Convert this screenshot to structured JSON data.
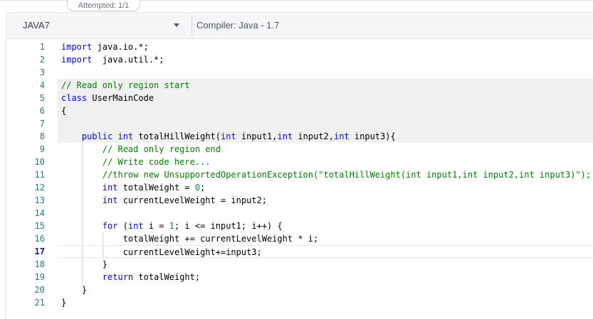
{
  "header": {
    "attempt_label": "Attempted: 1/1"
  },
  "toolbar": {
    "language": "JAVA7",
    "compiler": "Compiler: Java - 1.7",
    "dropdown_icon": "caret-down-icon"
  },
  "editor": {
    "active_line": 17,
    "lines": [
      {
        "n": "1",
        "tokens": [
          {
            "t": "kw",
            "v": "import"
          },
          {
            "t": "p",
            "v": " java.io.*;"
          }
        ]
      },
      {
        "n": "2",
        "tokens": [
          {
            "t": "kw",
            "v": "import"
          },
          {
            "t": "p",
            "v": "  java.util.*;"
          }
        ]
      },
      {
        "n": "3",
        "tokens": []
      },
      {
        "n": "4",
        "tokens": [
          {
            "t": "cm",
            "v": "// Read only region start"
          }
        ]
      },
      {
        "n": "5",
        "tokens": [
          {
            "t": "kw",
            "v": "class"
          },
          {
            "t": "p",
            "v": " UserMainCode"
          }
        ]
      },
      {
        "n": "6",
        "tokens": [
          {
            "t": "p",
            "v": "{"
          }
        ]
      },
      {
        "n": "7",
        "tokens": []
      },
      {
        "n": "8",
        "tokens": [
          {
            "t": "p",
            "v": "    "
          },
          {
            "t": "kw",
            "v": "public"
          },
          {
            "t": "p",
            "v": " "
          },
          {
            "t": "kw",
            "v": "int"
          },
          {
            "t": "p",
            "v": " totalHillWeight("
          },
          {
            "t": "kw",
            "v": "int"
          },
          {
            "t": "p",
            "v": " input1,"
          },
          {
            "t": "kw",
            "v": "int"
          },
          {
            "t": "p",
            "v": " input2,"
          },
          {
            "t": "kw",
            "v": "int"
          },
          {
            "t": "p",
            "v": " input3){"
          }
        ]
      },
      {
        "n": "9",
        "tokens": [
          {
            "t": "p",
            "v": "        "
          },
          {
            "t": "cm",
            "v": "// Read only region end"
          }
        ]
      },
      {
        "n": "10",
        "tokens": [
          {
            "t": "p",
            "v": "        "
          },
          {
            "t": "cm",
            "v": "// Write code here..."
          }
        ]
      },
      {
        "n": "11",
        "tokens": [
          {
            "t": "p",
            "v": "        "
          },
          {
            "t": "cm",
            "v": "//throw new UnsupportedOperationException(\"totalHillWeight(int input1,int input2,int input3)\");"
          }
        ]
      },
      {
        "n": "12",
        "tokens": [
          {
            "t": "p",
            "v": "        "
          },
          {
            "t": "kw",
            "v": "int"
          },
          {
            "t": "p",
            "v": " totalWeight = "
          },
          {
            "t": "num",
            "v": "0"
          },
          {
            "t": "p",
            "v": ";"
          }
        ]
      },
      {
        "n": "13",
        "tokens": [
          {
            "t": "p",
            "v": "        "
          },
          {
            "t": "kw",
            "v": "int"
          },
          {
            "t": "p",
            "v": " currentLevelWeight = input2;"
          }
        ]
      },
      {
        "n": "14",
        "tokens": []
      },
      {
        "n": "15",
        "tokens": [
          {
            "t": "p",
            "v": "        "
          },
          {
            "t": "kw",
            "v": "for"
          },
          {
            "t": "p",
            "v": " ("
          },
          {
            "t": "kw",
            "v": "int"
          },
          {
            "t": "p",
            "v": " i = "
          },
          {
            "t": "num",
            "v": "1"
          },
          {
            "t": "p",
            "v": "; i <= input1; i++) {"
          }
        ]
      },
      {
        "n": "16",
        "tokens": [
          {
            "t": "p",
            "v": "            totalWeight += currentLevelWeight * i;"
          }
        ]
      },
      {
        "n": "17",
        "tokens": [
          {
            "t": "p",
            "v": "            currentLevelWeight+=input3;"
          }
        ]
      },
      {
        "n": "18",
        "tokens": [
          {
            "t": "p",
            "v": "        }"
          }
        ]
      },
      {
        "n": "19",
        "tokens": [
          {
            "t": "p",
            "v": "        "
          },
          {
            "t": "kw",
            "v": "return"
          },
          {
            "t": "p",
            "v": " totalWeight;"
          }
        ]
      },
      {
        "n": "20",
        "tokens": [
          {
            "t": "p",
            "v": "    }"
          }
        ]
      },
      {
        "n": "21",
        "tokens": [
          {
            "t": "p",
            "v": "}"
          }
        ]
      }
    ]
  }
}
